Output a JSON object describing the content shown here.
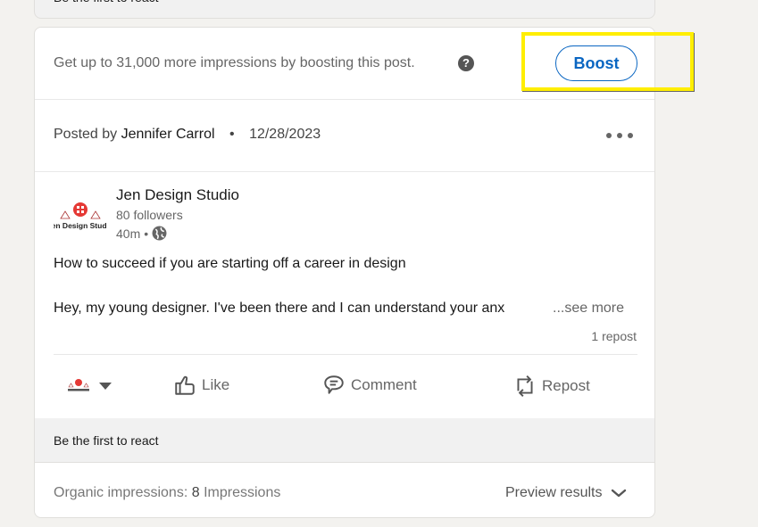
{
  "previous_card": {
    "reaction_prompt": "Be the first to react"
  },
  "boost": {
    "message": "Get up to 31,000 more impressions by boosting this post.",
    "help_icon": "question-circle-icon",
    "button_label": "Boost",
    "accent_color": "#0a66c2"
  },
  "highlight": {
    "color": "#ffee00",
    "target": "boost-button"
  },
  "post_meta": {
    "posted_by_label": "Posted by",
    "author": "Jennifer Carrol",
    "separator": "•",
    "date": "12/28/2023",
    "more_icon": "ellipsis-icon"
  },
  "organization": {
    "name": "Jen Design Studio",
    "logo_text": "Jen Design Studio",
    "followers": "80 followers",
    "age": "40m",
    "age_separator": "•",
    "visibility_icon": "globe-icon"
  },
  "post": {
    "title": "How to succeed if you are starting off a career in design",
    "body_preview": "Hey, my young designer. I've been there and I can understand your anx",
    "see_more_label": "...see more",
    "repost_count": "1 repost"
  },
  "actions": [
    {
      "label": "Like",
      "icon": "thumbs-up-icon"
    },
    {
      "label": "Comment",
      "icon": "comment-icon"
    },
    {
      "label": "Repost",
      "icon": "repost-icon"
    }
  ],
  "reactions": {
    "prompt": "Be the first to react"
  },
  "impressions": {
    "label": "Organic impressions:",
    "count": "8",
    "unit": "Impressions",
    "preview_label": "Preview results",
    "preview_icon": "chevron-down-icon"
  }
}
